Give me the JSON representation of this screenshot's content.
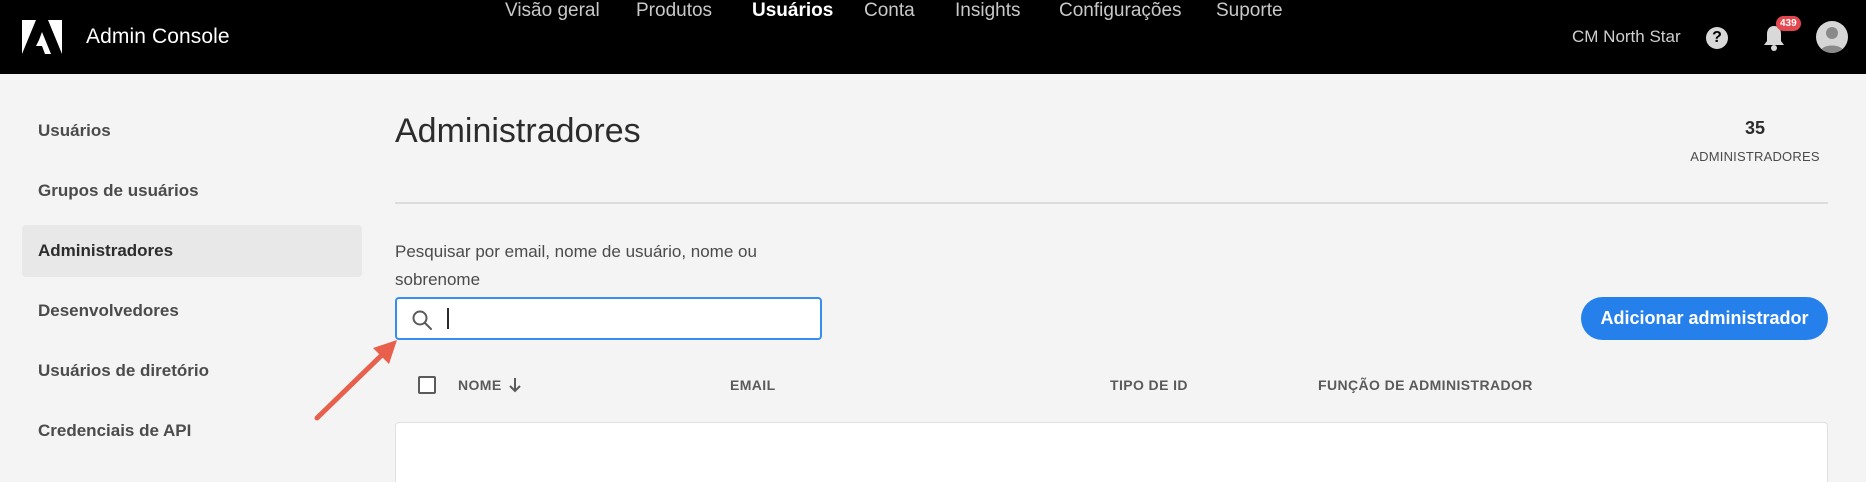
{
  "header": {
    "app_title": "Admin Console",
    "nav": [
      {
        "label": "Visão geral",
        "active": false
      },
      {
        "label": "Produtos",
        "active": false
      },
      {
        "label": "Usuários",
        "active": true
      },
      {
        "label": "Conta",
        "active": false
      },
      {
        "label": "Insights",
        "active": false
      },
      {
        "label": "Configurações",
        "active": false
      },
      {
        "label": "Suporte",
        "active": false
      }
    ],
    "org_name": "CM North Star",
    "help_glyph": "?",
    "notification_count": "439"
  },
  "sidebar": {
    "items": [
      {
        "label": "Usuários",
        "active": false
      },
      {
        "label": "Grupos de usuários",
        "active": false
      },
      {
        "label": "Administradores",
        "active": true
      },
      {
        "label": "Desenvolvedores",
        "active": false
      },
      {
        "label": "Usuários de diretório",
        "active": false
      },
      {
        "label": "Credenciais de API",
        "active": false
      }
    ]
  },
  "main": {
    "title": "Administradores",
    "count": "35",
    "count_label": "ADMINISTRADORES",
    "search": {
      "label": "Pesquisar por email, nome de usuário, nome ou sobrenome",
      "value": ""
    },
    "add_button": "Adicionar administrador",
    "table": {
      "columns": [
        "NOME",
        "EMAIL",
        "TIPO DE ID",
        "FUNÇÃO DE ADMINISTRADOR"
      ],
      "sort_column": "NOME",
      "sort_direction": "descending"
    }
  },
  "colors": {
    "accent": "#2680eb",
    "topbar": "#000000",
    "badge": "#e34850",
    "annotation_arrow": "#e8604c"
  }
}
